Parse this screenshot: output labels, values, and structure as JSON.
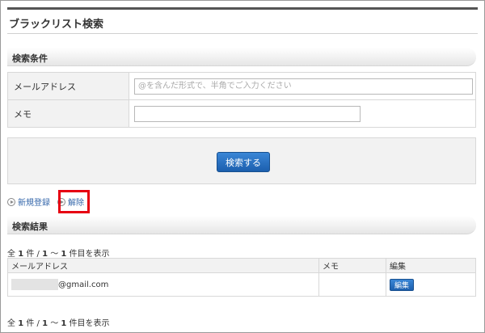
{
  "page": {
    "title": "ブラックリスト検索"
  },
  "conditions": {
    "heading": "検索条件",
    "email_label": "メールアドレス",
    "email_placeholder": "@を含んだ形式で、半角でご入力ください",
    "memo_label": "メモ",
    "memo_value": "",
    "search_button": "検索する"
  },
  "actions": {
    "new_register": "新規登録",
    "release": "解除"
  },
  "results": {
    "heading": "検索結果",
    "count_prefix": "全 ",
    "total": "1",
    "count_mid": " 件 / ",
    "range_start": "1",
    "range_sep": " ～ ",
    "range_end": "1",
    "count_suffix": " 件目を表示",
    "columns": {
      "email": "メールアドレス",
      "memo": "メモ",
      "edit": "編集"
    },
    "rows": [
      {
        "email_visible": "@gmail.com",
        "memo": "",
        "edit_label": "編集"
      }
    ]
  },
  "colors": {
    "accent": "#1c5fae",
    "highlight": "#e60012",
    "link": "#3366aa"
  }
}
